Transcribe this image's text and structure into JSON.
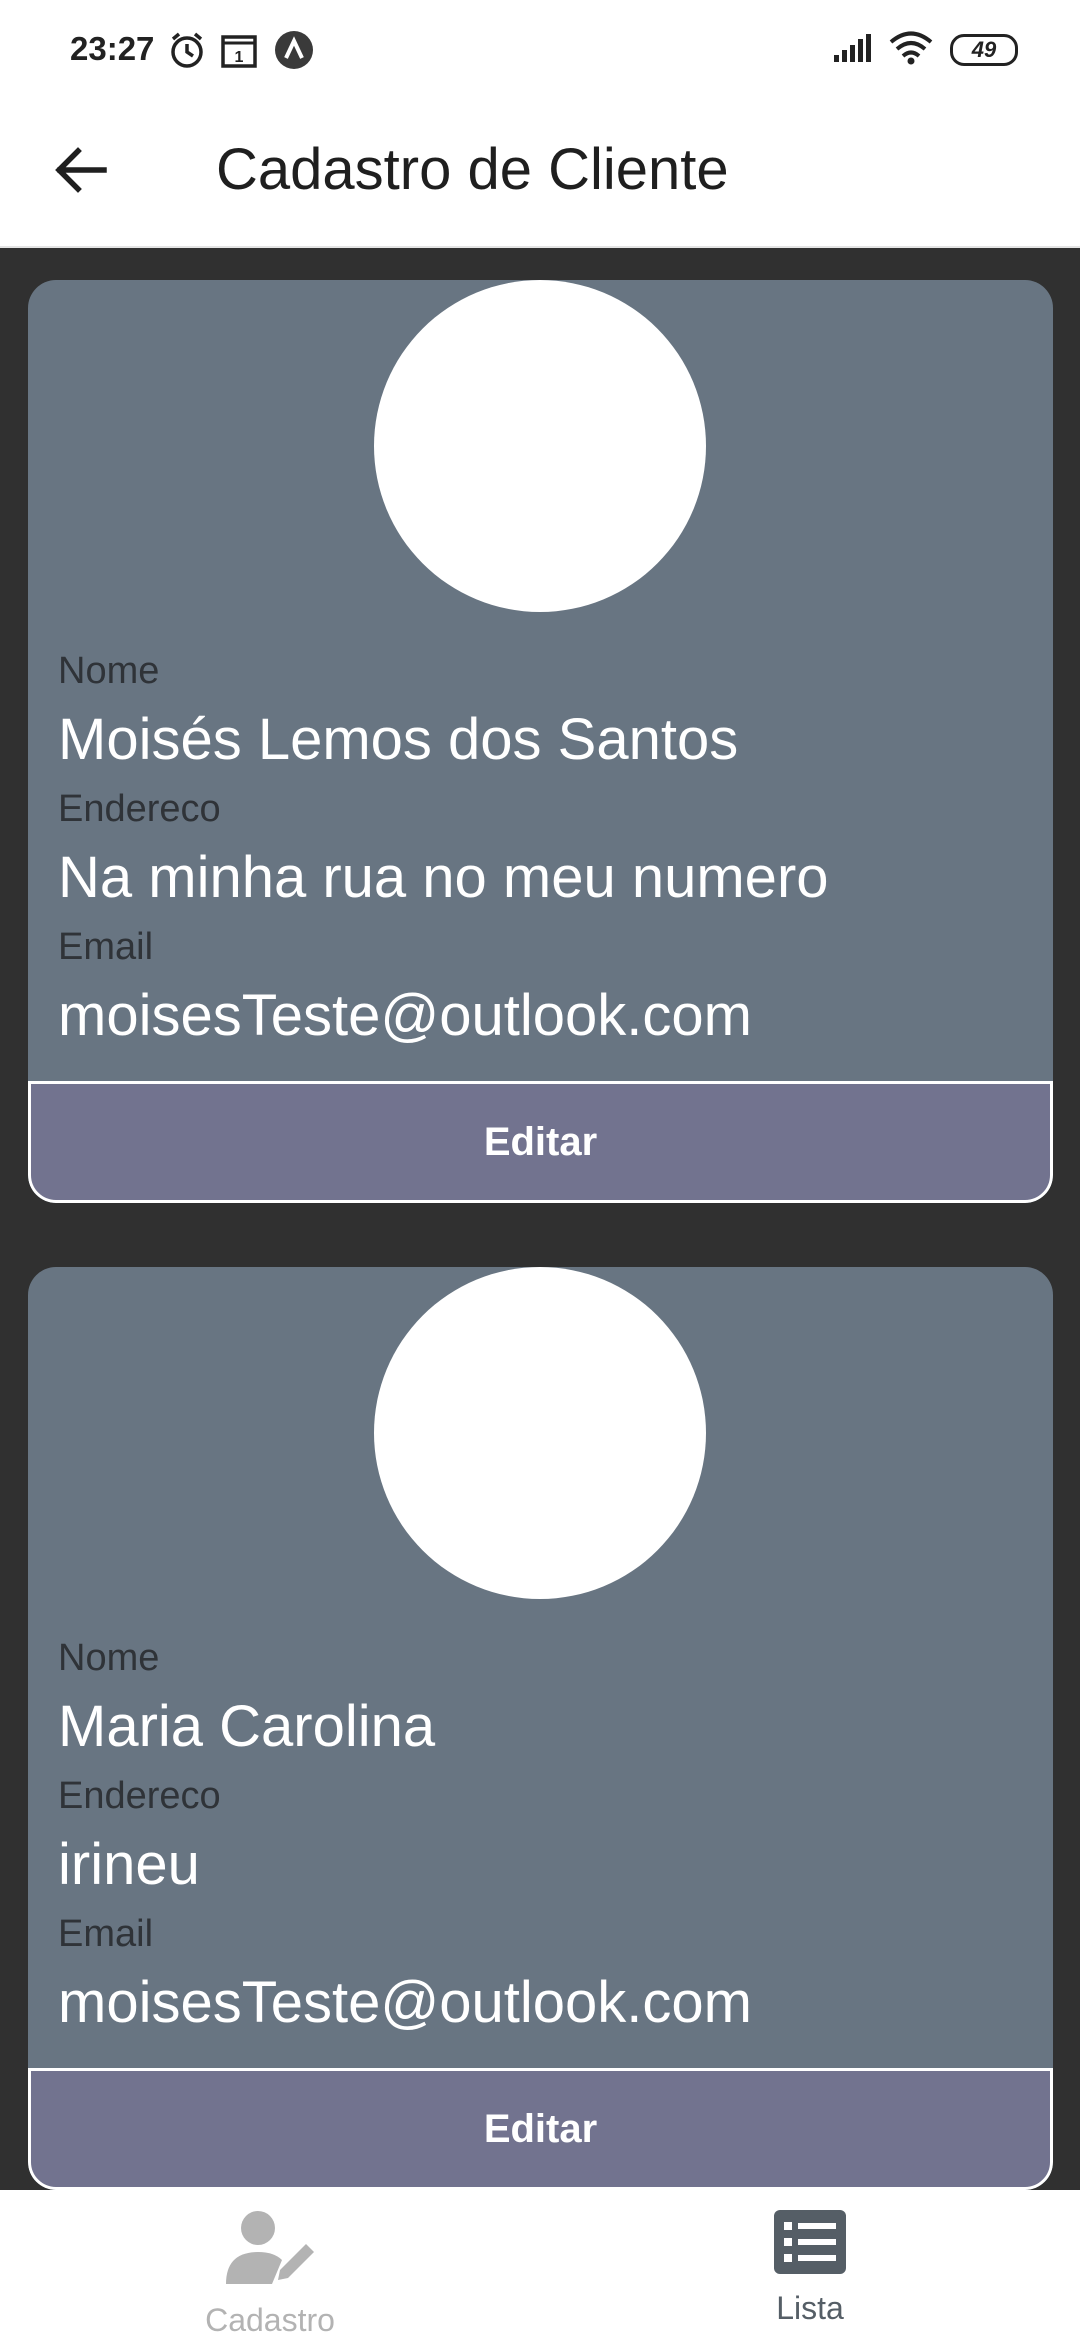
{
  "status_bar": {
    "time": "23:27",
    "battery": "49",
    "icons": [
      "alarm-icon",
      "calendar-icon",
      "app-notification-icon",
      "signal-icon",
      "wifi-icon",
      "battery-icon"
    ]
  },
  "app_bar": {
    "title": "Cadastro de Cliente",
    "back_icon": "arrow-left-icon"
  },
  "clients": [
    {
      "nome_label": "Nome",
      "nome": "Moisés Lemos dos Santos",
      "endereco_label": "Endereco",
      "endereco": "Na minha rua no meu numero",
      "email_label": "Email",
      "email": "moisesTeste@outlook.com",
      "edit_label": "Editar"
    },
    {
      "nome_label": "Nome",
      "nome": "Maria Carolina",
      "endereco_label": "Endereco",
      "endereco": "irineu",
      "email_label": "Email",
      "email": "moisesTeste@outlook.com",
      "edit_label": "Editar"
    }
  ],
  "bottom_nav": {
    "items": [
      {
        "label": "Cadastro",
        "icon": "user-edit-icon",
        "active": false
      },
      {
        "label": "Lista",
        "icon": "list-icon",
        "active": true
      }
    ]
  },
  "colors": {
    "card_bg": "#687582",
    "button_bg": "#72738f",
    "page_bg": "#303030",
    "nav_active": "#555e66",
    "nav_inactive": "#b3b3b3"
  }
}
